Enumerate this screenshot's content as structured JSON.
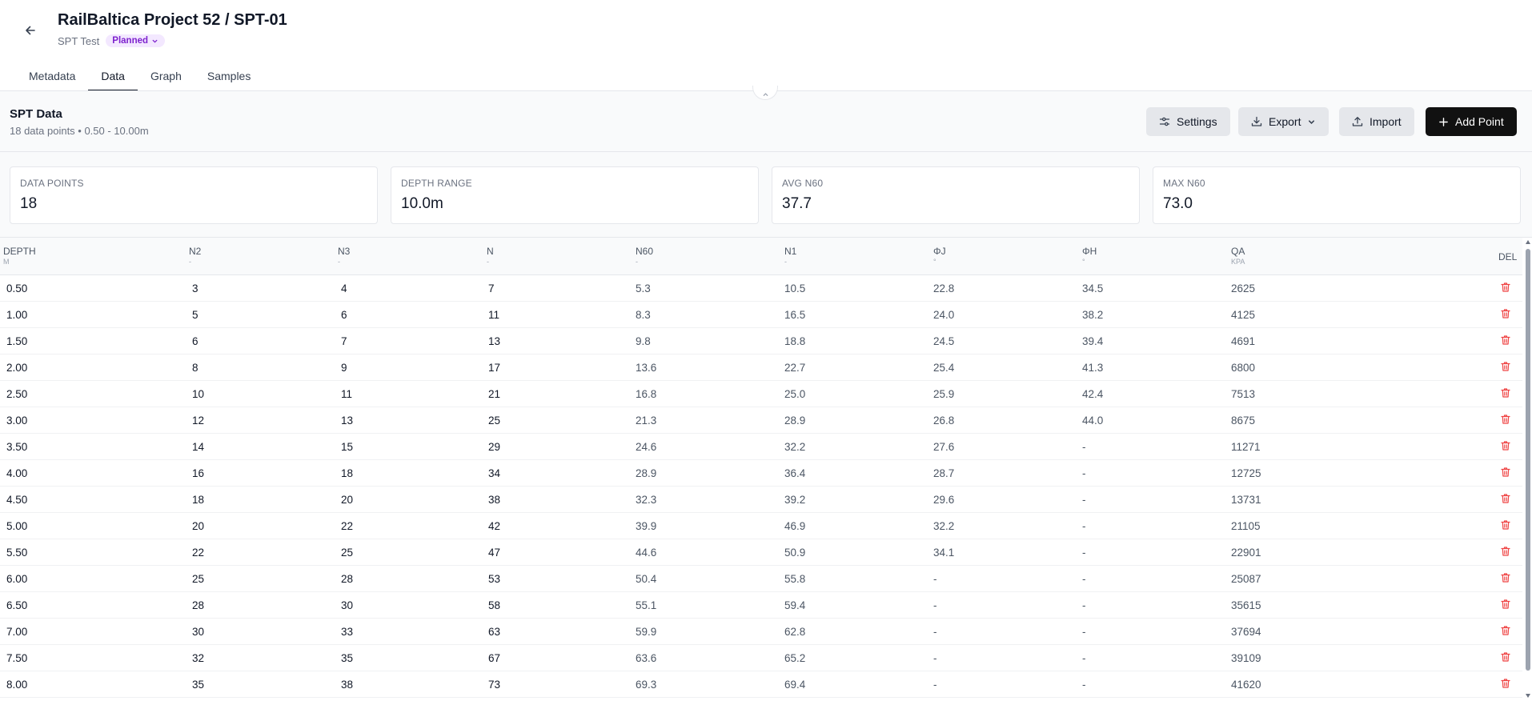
{
  "header": {
    "title": "RailBaltica Project 52 / SPT-01",
    "subtitle": "SPT Test",
    "status_badge": "Planned"
  },
  "tabs": [
    {
      "label": "Metadata",
      "active": false
    },
    {
      "label": "Data",
      "active": true
    },
    {
      "label": "Graph",
      "active": false
    },
    {
      "label": "Samples",
      "active": false
    }
  ],
  "section": {
    "title": "SPT Data",
    "subtitle": "18 data points • 0.50 - 10.00m"
  },
  "toolbar": {
    "settings_label": "Settings",
    "export_label": "Export",
    "import_label": "Import",
    "add_point_label": "Add Point"
  },
  "stats": [
    {
      "label": "DATA POINTS",
      "value": "18"
    },
    {
      "label": "DEPTH RANGE",
      "value": "10.0m"
    },
    {
      "label": "AVG N60",
      "value": "37.7"
    },
    {
      "label": "MAX N60",
      "value": "73.0"
    }
  ],
  "columns": [
    {
      "name": "DEPTH",
      "unit": "M"
    },
    {
      "name": "N2",
      "unit": "-"
    },
    {
      "name": "N3",
      "unit": "-"
    },
    {
      "name": "N",
      "unit": "-"
    },
    {
      "name": "N60",
      "unit": "-"
    },
    {
      "name": "N1",
      "unit": "-"
    },
    {
      "name": "ΦJ",
      "unit": "°"
    },
    {
      "name": "ΦH",
      "unit": "°"
    },
    {
      "name": "QA",
      "unit": "KPA"
    }
  ],
  "del_header": "DEL",
  "rows": [
    [
      "0.50",
      "3",
      "4",
      "7",
      "5.3",
      "10.5",
      "22.8",
      "34.5",
      "2625"
    ],
    [
      "1.00",
      "5",
      "6",
      "11",
      "8.3",
      "16.5",
      "24.0",
      "38.2",
      "4125"
    ],
    [
      "1.50",
      "6",
      "7",
      "13",
      "9.8",
      "18.8",
      "24.5",
      "39.4",
      "4691"
    ],
    [
      "2.00",
      "8",
      "9",
      "17",
      "13.6",
      "22.7",
      "25.4",
      "41.3",
      "6800"
    ],
    [
      "2.50",
      "10",
      "11",
      "21",
      "16.8",
      "25.0",
      "25.9",
      "42.4",
      "7513"
    ],
    [
      "3.00",
      "12",
      "13",
      "25",
      "21.3",
      "28.9",
      "26.8",
      "44.0",
      "8675"
    ],
    [
      "3.50",
      "14",
      "15",
      "29",
      "24.6",
      "32.2",
      "27.6",
      "-",
      "11271"
    ],
    [
      "4.00",
      "16",
      "18",
      "34",
      "28.9",
      "36.4",
      "28.7",
      "-",
      "12725"
    ],
    [
      "4.50",
      "18",
      "20",
      "38",
      "32.3",
      "39.2",
      "29.6",
      "-",
      "13731"
    ],
    [
      "5.00",
      "20",
      "22",
      "42",
      "39.9",
      "46.9",
      "32.2",
      "-",
      "21105"
    ],
    [
      "5.50",
      "22",
      "25",
      "47",
      "44.6",
      "50.9",
      "34.1",
      "-",
      "22901"
    ],
    [
      "6.00",
      "25",
      "28",
      "53",
      "50.4",
      "55.8",
      "-",
      "-",
      "25087"
    ],
    [
      "6.50",
      "28",
      "30",
      "58",
      "55.1",
      "59.4",
      "-",
      "-",
      "35615"
    ],
    [
      "7.00",
      "30",
      "33",
      "63",
      "59.9",
      "62.8",
      "-",
      "-",
      "37694"
    ],
    [
      "7.50",
      "32",
      "35",
      "67",
      "63.6",
      "65.2",
      "-",
      "-",
      "39109"
    ],
    [
      "8.00",
      "35",
      "38",
      "73",
      "69.3",
      "69.4",
      "-",
      "-",
      "41620"
    ]
  ],
  "colors": {
    "primary": "#111111",
    "badge_bg": "#f3e8ff",
    "badge_text": "#7e22ce",
    "delete": "#ef4444"
  }
}
